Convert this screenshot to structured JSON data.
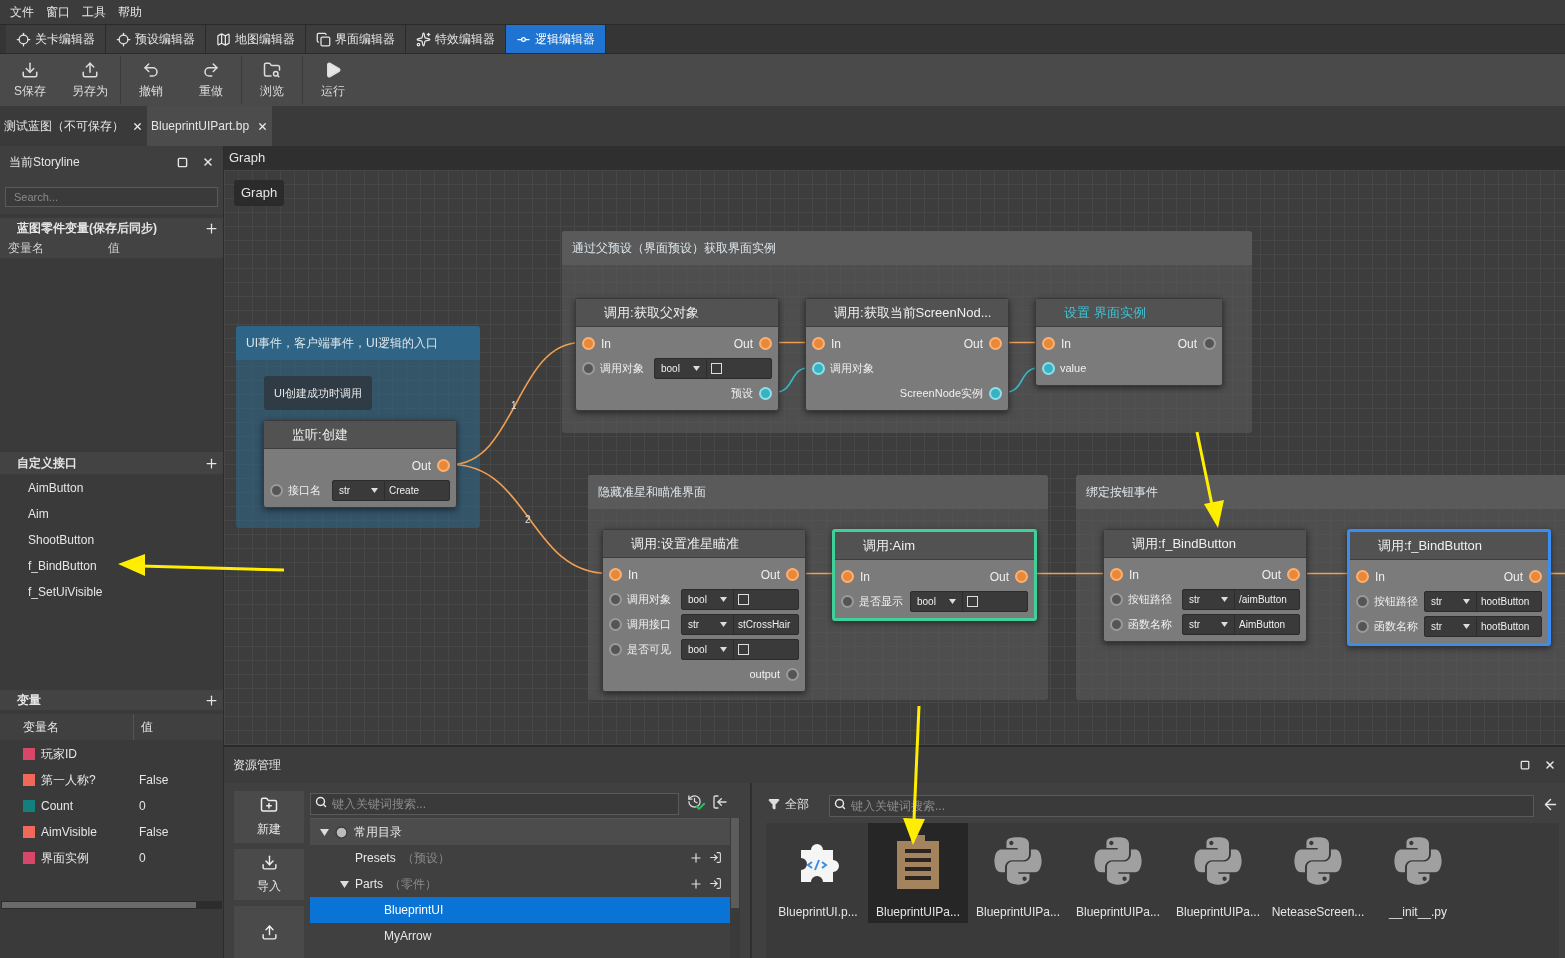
{
  "menu": [
    "文件",
    "窗口",
    "工具",
    "帮助"
  ],
  "editor_tabs": [
    {
      "label": "关卡编辑器",
      "selected": false
    },
    {
      "label": "预设编辑器",
      "selected": false
    },
    {
      "label": "地图编辑器",
      "selected": false
    },
    {
      "label": "界面编辑器",
      "selected": false
    },
    {
      "label": "特效编辑器",
      "selected": false
    },
    {
      "label": "逻辑编辑器",
      "selected": true
    }
  ],
  "toolbar": [
    {
      "label": "S保存"
    },
    {
      "label": "另存为"
    },
    {
      "label": "撤销"
    },
    {
      "label": "重做"
    },
    {
      "label": "浏览"
    },
    {
      "label": "运行"
    }
  ],
  "doc_tabs": [
    {
      "label": "测试蓝图（不可保存）",
      "selected": false
    },
    {
      "label": "BlueprintUIPart.bp",
      "selected": true
    }
  ],
  "left_panel": {
    "title": "当前Storyline",
    "search_placeholder": "Search...",
    "blueprint_vars": {
      "title": "蓝图零件变量(保存后同步)",
      "columns": [
        "变量名",
        "值"
      ]
    },
    "interfaces": {
      "title": "自定义接口",
      "items": [
        "AimButton",
        "Aim",
        "ShootButton",
        "f_BindButton",
        "f_SetUiVisible"
      ]
    },
    "variables": {
      "title": "变量",
      "columns": [
        "变量名",
        "值"
      ],
      "rows": [
        {
          "name": "玩家ID",
          "color": "#d9466a"
        },
        {
          "name": "第一人称?",
          "value": "False",
          "color": "#f0685a"
        },
        {
          "name": "Count",
          "value": "0",
          "color": "#14807e"
        },
        {
          "name": "AimVisible",
          "value": "False",
          "color": "#f0685a"
        },
        {
          "name": "界面实例",
          "value": "0",
          "color": "#d9466a"
        }
      ]
    }
  },
  "graph": {
    "title": "Graph",
    "breadcrumb": "Graph",
    "groups": [
      {
        "title": "UI事件，客户端事件，UI逻辑的入口",
        "color": "#2e6486"
      },
      {
        "title": "通过父预设（界面预设）获取界面实例",
        "color": "#5a5a5a"
      },
      {
        "title": "隐藏准星和瞄准界面",
        "color": "#5a5a5a"
      },
      {
        "title": "绑定按钮事件",
        "color": "#5a5a5a"
      }
    ],
    "wire_labels": [
      "1",
      "2"
    ],
    "nodes": [
      {
        "title": "监听:创建",
        "comment": "UI创建成功时调用",
        "kind": "call",
        "rows": [
          {
            "kind": "exec",
            "out": "Out",
            "out_connected": true
          },
          {
            "kind": "input",
            "label": "接口名",
            "connected": false,
            "type": "str",
            "value": "Create"
          }
        ]
      },
      {
        "title": "调用:获取父对象",
        "kind": "call",
        "rows": [
          {
            "kind": "exec",
            "in": "In",
            "out": "Out",
            "out_connected": true
          },
          {
            "kind": "input",
            "label": "调用对象",
            "connected": false,
            "type": "bool",
            "checked": false
          },
          {
            "kind": "output",
            "label": "预设",
            "connected": true
          }
        ]
      },
      {
        "title": "调用:获取当前ScreenNod...",
        "kind": "call",
        "rows": [
          {
            "kind": "exec",
            "in": "In",
            "out": "Out",
            "out_connected": true
          },
          {
            "kind": "input",
            "label": "调用对象",
            "connected": true
          },
          {
            "kind": "output",
            "label": "ScreenNode实例",
            "connected": true
          }
        ]
      },
      {
        "title": "设置 界面实例",
        "kind": "setter",
        "rows": [
          {
            "kind": "exec",
            "in": "In",
            "out": "Out",
            "out_connected": false
          },
          {
            "kind": "input",
            "label": "value",
            "connected": true
          }
        ]
      },
      {
        "title": "调用:设置准星瞄准",
        "kind": "call",
        "rows": [
          {
            "kind": "exec",
            "in": "In",
            "out": "Out",
            "out_connected": true
          },
          {
            "kind": "input",
            "label": "调用对象",
            "connected": false,
            "type": "bool",
            "checked": false
          },
          {
            "kind": "input",
            "label": "调用接口",
            "connected": false,
            "type": "str",
            "value": "stCrossHair"
          },
          {
            "kind": "input",
            "label": "是否可见",
            "connected": false,
            "type": "bool",
            "checked": false
          },
          {
            "kind": "output",
            "label": "output",
            "connected": false
          }
        ]
      },
      {
        "title": "调用:Aim",
        "kind": "call",
        "color": "#3fd19a",
        "rows": [
          {
            "kind": "exec",
            "in": "In",
            "out": "Out",
            "out_connected": true
          },
          {
            "kind": "input",
            "label": "是否显示",
            "connected": false,
            "type": "bool",
            "checked": false
          }
        ]
      },
      {
        "title": "调用:f_BindButton",
        "kind": "call",
        "rows": [
          {
            "kind": "exec",
            "in": "In",
            "out": "Out",
            "out_connected": true
          },
          {
            "kind": "input",
            "label": "按钮路径",
            "connected": false,
            "type": "str",
            "value": "/aimButton"
          },
          {
            "kind": "input",
            "label": "函数名称",
            "connected": false,
            "type": "str",
            "value": "AimButton"
          }
        ]
      },
      {
        "title": "调用:f_BindButton",
        "kind": "call",
        "color": "#3a8df2",
        "rows": [
          {
            "kind": "exec",
            "in": "In",
            "out": "Out",
            "out_connected": true
          },
          {
            "kind": "input",
            "label": "按钮路径",
            "connected": false,
            "type": "str",
            "value": "hootButton"
          },
          {
            "kind": "input",
            "label": "函数名称",
            "connected": false,
            "type": "str",
            "value": "hootButton"
          }
        ]
      }
    ]
  },
  "resources": {
    "title": "资源管理",
    "actions": [
      {
        "kind": "new",
        "label": "新建"
      },
      {
        "kind": "import",
        "label": "导入"
      },
      {
        "kind": "export"
      }
    ],
    "tree": {
      "search_placeholder": "键入关键词搜索...",
      "items": [
        {
          "label": "常用目录",
          "kind": "root",
          "expanded": true,
          "selected": false,
          "children": [
            {
              "label": "Presets",
              "note": "（预设）",
              "kind": "folder",
              "selected": false
            },
            {
              "label": "Parts",
              "note": "（零件）",
              "kind": "folder",
              "expanded": true,
              "selected": false,
              "children": [
                {
                  "label": "BlueprintUI",
                  "kind": "file",
                  "selected": true
                },
                {
                  "label": "MyArrow",
                  "kind": "file",
                  "selected": false
                }
              ]
            }
          ]
        }
      ]
    },
    "files": {
      "filter": "全部",
      "search_placeholder": "键入关键词搜索...",
      "items": [
        {
          "name": "BlueprintUI.p...",
          "kind": "blueprint",
          "selected": false
        },
        {
          "name": "BlueprintUIPa...",
          "kind": "part",
          "selected": true
        },
        {
          "name": "BlueprintUIPa...",
          "kind": "python",
          "selected": false
        },
        {
          "name": "BlueprintUIPa...",
          "kind": "python",
          "selected": false
        },
        {
          "name": "BlueprintUIPa...",
          "kind": "python",
          "selected": false
        },
        {
          "name": "NeteaseScreen...",
          "kind": "python",
          "selected": false
        },
        {
          "name": "__init__.py",
          "kind": "python",
          "selected": false
        }
      ]
    }
  }
}
